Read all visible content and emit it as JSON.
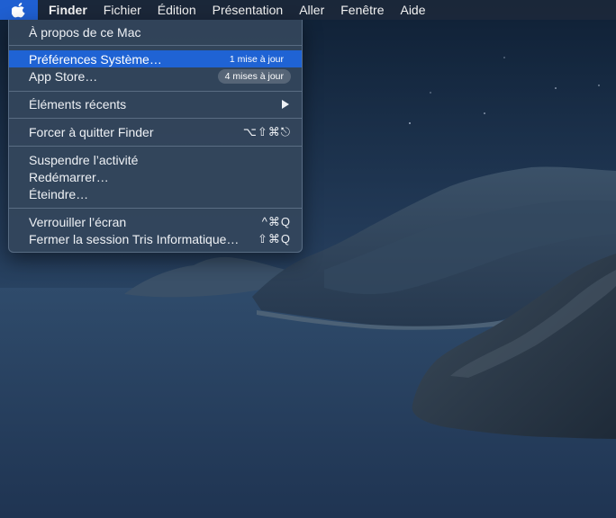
{
  "menubar": {
    "apple_icon": "apple-icon",
    "items": [
      "Finder",
      "Fichier",
      "Édition",
      "Présentation",
      "Aller",
      "Fenêtre",
      "Aide"
    ]
  },
  "apple_menu": {
    "about": "À propos de ce Mac",
    "system_prefs": {
      "label": "Préférences Système…",
      "badge": "1 mise à jour"
    },
    "app_store": {
      "label": "App Store…",
      "badge": "4 mises à jour"
    },
    "recent_items": {
      "label": "Éléments récents",
      "submenu_icon": "chevron-right-icon"
    },
    "force_quit": {
      "label": "Forcer à quitter Finder",
      "shortcut": "⌥⇧⌘⎋"
    },
    "sleep": "Suspendre l’activité",
    "restart": "Redémarrer…",
    "shutdown": "Éteindre…",
    "lock_screen": {
      "label": "Verrouiller l’écran",
      "shortcut": "^⌘Q"
    },
    "logout": {
      "label": "Fermer la session Tris Informatique…",
      "shortcut": "⇧⌘Q"
    }
  },
  "colors": {
    "highlight": "#1f63d4",
    "menubar_bg": "#1c283a",
    "menu_bg": "#34465c"
  }
}
